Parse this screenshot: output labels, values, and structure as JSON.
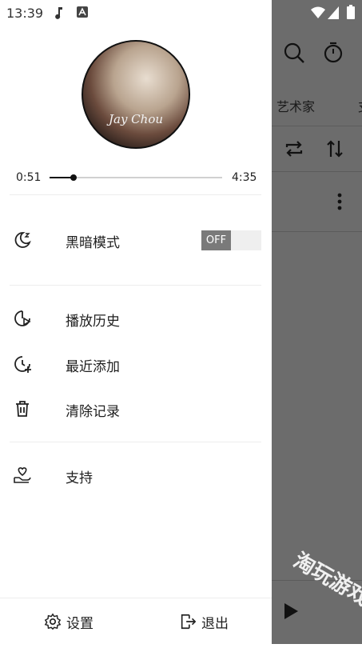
{
  "status_bar": {
    "time": "13:39"
  },
  "background_app": {
    "tab_artists": "艺术家",
    "tab_next_partial": "支"
  },
  "album_art": {
    "text": "Jay Chou"
  },
  "player": {
    "current_time": "0:51",
    "total_time": "4:35",
    "progress_fraction": 0.14
  },
  "drawer": {
    "dark_mode": {
      "label": "黑暗模式",
      "state": "OFF"
    },
    "items": [
      {
        "label": "播放历史",
        "icon": "play-history-icon"
      },
      {
        "label": "最近添加",
        "icon": "recently-added-icon"
      },
      {
        "label": "清除记录",
        "icon": "trash-icon"
      }
    ],
    "support": {
      "label": "支持",
      "icon": "heart-hand-icon"
    }
  },
  "footer": {
    "settings_label": "设置",
    "exit_label": "退出"
  },
  "watermark": {
    "text": "淘玩游戏"
  },
  "colors": {
    "overlay": "#6c6c6c",
    "toggle_knob": "#7a7a7a",
    "text": "#1f1f1f"
  }
}
